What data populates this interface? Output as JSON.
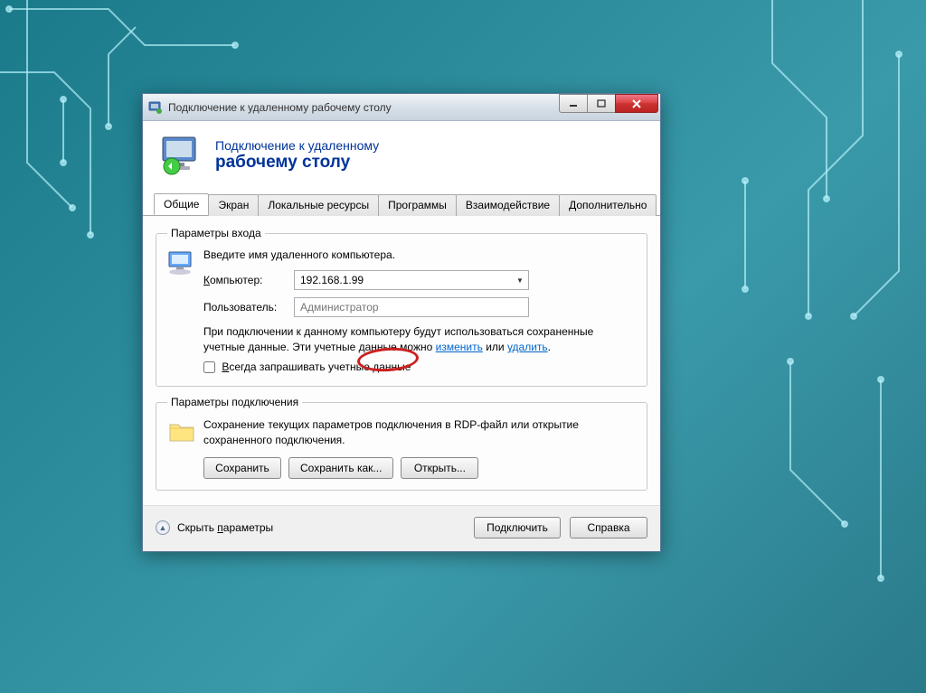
{
  "titlebar": {
    "title": "Подключение к удаленному рабочему столу"
  },
  "header": {
    "line1": "Подключение к удаленному",
    "line2": "рабочему столу"
  },
  "tabs": [
    {
      "label": "Общие"
    },
    {
      "label": "Экран"
    },
    {
      "label": "Локальные ресурсы"
    },
    {
      "label": "Программы"
    },
    {
      "label": "Взаимодействие"
    },
    {
      "label": "Дополнительно"
    }
  ],
  "login_group": {
    "legend": "Параметры входа",
    "instruction": "Введите имя удаленного компьютера.",
    "computer_label": "Компьютер:",
    "computer_accesskey": "К",
    "computer_value": "192.168.1.99",
    "user_label": "Пользователь:",
    "user_placeholder": "Администратор",
    "cred_text_1": "При подключении к данному компьютеру будут использоваться сохраненные учетные данные. Эти учетные данные можно ",
    "cred_link_edit": "изменить",
    "cred_text_2": " или ",
    "cred_link_delete": "удалить",
    "cred_text_3": ".",
    "always_ask_label": "Всегда запрашивать учетные данные",
    "always_ask_accesskey": "В"
  },
  "conn_group": {
    "legend": "Параметры подключения",
    "text": "Сохранение текущих параметров подключения в RDP-файл или открытие сохраненного подключения.",
    "save_btn": "Сохранить",
    "saveas_btn": "Сохранить как...",
    "open_btn": "Открыть..."
  },
  "footer": {
    "collapse_label": "Скрыть параметры",
    "collapse_accesskey": "п",
    "connect_btn": "Подключить",
    "help_btn": "Справка"
  }
}
